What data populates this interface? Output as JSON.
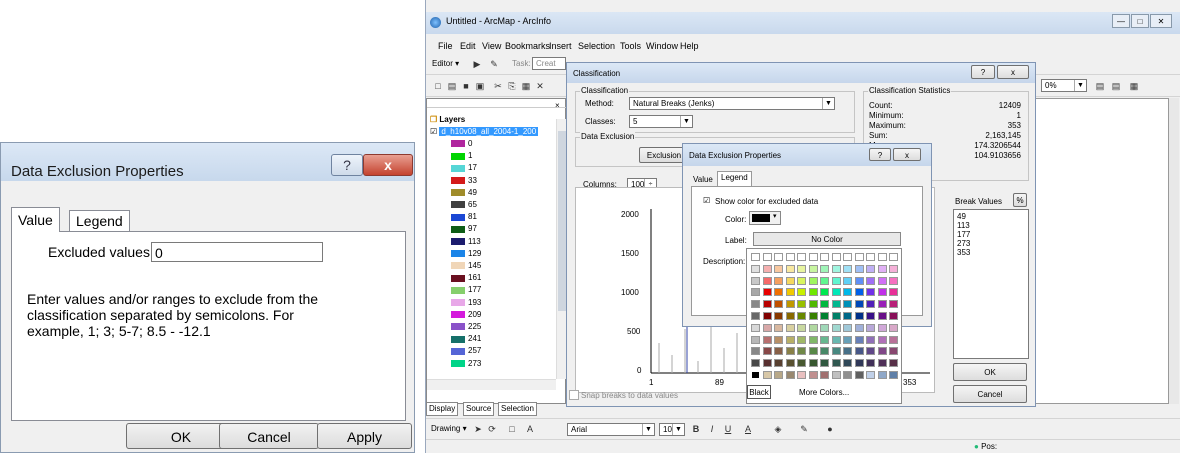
{
  "left_dialog": {
    "title": "Data Exclusion Properties",
    "help": "?",
    "close": "x",
    "tabs": [
      "Value",
      "Legend"
    ],
    "excluded_label": "Excluded values:",
    "excluded_value": "0",
    "description": "Enter values and/or ranges to exclude from the classification separated by semicolons. For example, 1; 3; 5-7; 8.5 - -12.1",
    "buttons": [
      "OK",
      "Cancel",
      "Apply"
    ]
  },
  "arcmap": {
    "title": "Untitled - ArcMap - ArcInfo",
    "menu": [
      "File",
      "Edit",
      "View",
      "Bookmarks",
      "Insert",
      "Selection",
      "Tools",
      "Window",
      "Help"
    ],
    "editor_label": "Editor ▾",
    "task_label": "Task:",
    "task_value": "Creat",
    "scale_value": "0%",
    "toc": {
      "layers_label": "Layers",
      "layer_name": "d_h10v08_all_2004-1_200",
      "classes": [
        {
          "v": "0",
          "c": "#b0269e"
        },
        {
          "v": "1",
          "c": "#00d400"
        },
        {
          "v": "17",
          "c": "#55d6d6"
        },
        {
          "v": "33",
          "c": "#d41a1a"
        },
        {
          "v": "49",
          "c": "#a08c2a"
        },
        {
          "v": "65",
          "c": "#404040"
        },
        {
          "v": "81",
          "c": "#1a47d4"
        },
        {
          "v": "97",
          "c": "#0d5c16"
        },
        {
          "v": "113",
          "c": "#1c1c6e"
        },
        {
          "v": "129",
          "c": "#1b85e8"
        },
        {
          "v": "145",
          "c": "#f0d6b8"
        },
        {
          "v": "161",
          "c": "#6a1020"
        },
        {
          "v": "177",
          "c": "#86cf6c"
        },
        {
          "v": "193",
          "c": "#e8a8e8"
        },
        {
          "v": "209",
          "c": "#d41adc"
        },
        {
          "v": "225",
          "c": "#8a52c9"
        },
        {
          "v": "241",
          "c": "#15706a"
        },
        {
          "v": "257",
          "c": "#5565d6"
        },
        {
          "v": "273",
          "c": "#00d488"
        }
      ],
      "tabs": [
        "Display",
        "Source",
        "Selection"
      ]
    },
    "drawing": {
      "label": "Drawing ▾",
      "font": "Arial",
      "size": "10",
      "bold": "B",
      "italic": "I",
      "underline": "U",
      "font_color": "A"
    },
    "status": "Pos:"
  },
  "classification": {
    "title": "Classification",
    "help": "?",
    "close": "x",
    "group_title": "Classification",
    "method_label": "Method:",
    "method_value": "Natural Breaks (Jenks)",
    "classes_label": "Classes:",
    "classes_value": "5",
    "exclusion_group": "Data Exclusion",
    "exclusion_btn": "Exclusion",
    "columns_label": "Columns:",
    "columns_value": "100",
    "stats_title": "Classification Statistics",
    "stats": [
      {
        "k": "Count:",
        "v": "12409"
      },
      {
        "k": "Minimum:",
        "v": "1"
      },
      {
        "k": "Maximum:",
        "v": "353"
      },
      {
        "k": "Sum:",
        "v": "2,163,145"
      },
      {
        "k": "Mean:",
        "v": "174.3206544"
      },
      {
        "k": "",
        "v": "104.9103656"
      }
    ],
    "break_title": "Break Values",
    "break_pct": "%",
    "breaks": [
      "49",
      "113",
      "177",
      "273",
      "353"
    ],
    "ok": "OK",
    "cancel": "Cancel",
    "snap": "Snap breaks to data values",
    "chart_y_ticks": [
      "2000",
      "1500",
      "1000",
      "500",
      "0"
    ],
    "chart_x_ticks": [
      "1",
      "89",
      "353"
    ],
    "chart_top_label": "49"
  },
  "dex_small": {
    "title": "Data Exclusion Properties",
    "help": "?",
    "close": "x",
    "tabs": [
      "Value",
      "Legend"
    ],
    "show_color": "Show color for excluded data",
    "color_label": "Color:",
    "label_label": "Label:",
    "label_value": "No Color",
    "desc_label": "Description:"
  },
  "palette": {
    "tooltip": "Black",
    "more_colors": "More Colors...",
    "rows": [
      [
        "#ffffff",
        "#ffffff",
        "#ffffff",
        "#ffffff",
        "#ffffff",
        "#ffffff",
        "#ffffff",
        "#ffffff",
        "#ffffff",
        "#ffffff",
        "#ffffff",
        "#ffffff",
        "#ffffff"
      ],
      [
        "#e0e0e0",
        "#f5b0b0",
        "#f8c8a0",
        "#f8e8a0",
        "#e8f5a0",
        "#c8f5a0",
        "#a0f5b8",
        "#a0f5e0",
        "#a0e0f5",
        "#a0c0f5",
        "#c0b0f5",
        "#e0b0f5",
        "#f5b0d8"
      ],
      [
        "#c8c8c8",
        "#f56a6a",
        "#f5a060",
        "#f5d860",
        "#d8f560",
        "#a0f560",
        "#60f590",
        "#60f5d0",
        "#60d0f5",
        "#6090f5",
        "#a070f5",
        "#d070f5",
        "#f570c0"
      ],
      [
        "#a8a8a8",
        "#e80000",
        "#f07000",
        "#f0c800",
        "#c8f000",
        "#70e800",
        "#00e850",
        "#00e8b8",
        "#00b8e8",
        "#0060e8",
        "#7030e8",
        "#c030e8",
        "#e83098"
      ],
      [
        "#888888",
        "#b80000",
        "#c05000",
        "#c09800",
        "#98c000",
        "#50b800",
        "#00b840",
        "#00b890",
        "#0090b8",
        "#0048b8",
        "#5020b8",
        "#9820b8",
        "#b82078"
      ],
      [
        "#686868",
        "#800000",
        "#883800",
        "#886800",
        "#688800",
        "#388000",
        "#008030",
        "#008068",
        "#006888",
        "#003088",
        "#381088",
        "#681088",
        "#881058"
      ],
      [
        "#d8d8d8",
        "#d8a8a8",
        "#d8b8a0",
        "#d8d0a0",
        "#c8d8a0",
        "#b0d8a0",
        "#a0d8b8",
        "#a0d8d0",
        "#a0c8d8",
        "#a0b0d8",
        "#b8a8d8",
        "#d0a8d8",
        "#d8a8c8"
      ],
      [
        "#b8b8b8",
        "#b87070",
        "#b89068",
        "#b8b068",
        "#a0b868",
        "#80b868",
        "#68b890",
        "#68b8b0",
        "#68a0b8",
        "#6880b8",
        "#9070b8",
        "#b070b8",
        "#b87098"
      ],
      [
        "#888888",
        "#884848",
        "#886048",
        "#888048",
        "#708848",
        "#588848",
        "#488868",
        "#488880",
        "#487088",
        "#485888",
        "#604888",
        "#804888",
        "#884870"
      ],
      [
        "#484848",
        "#583030",
        "#584030",
        "#585030",
        "#485830",
        "#385830",
        "#305840",
        "#305850",
        "#304858",
        "#303858",
        "#403058",
        "#503058",
        "#583048"
      ],
      [
        "#000000",
        "#d8c8a8",
        "#b8a888",
        "#988870",
        "#e8c0c0",
        "#c09090",
        "#a07070",
        "#c0c0c0",
        "#909090",
        "#606060",
        "#c0d0e8",
        "#90a8c8",
        "#6080a8"
      ]
    ]
  }
}
